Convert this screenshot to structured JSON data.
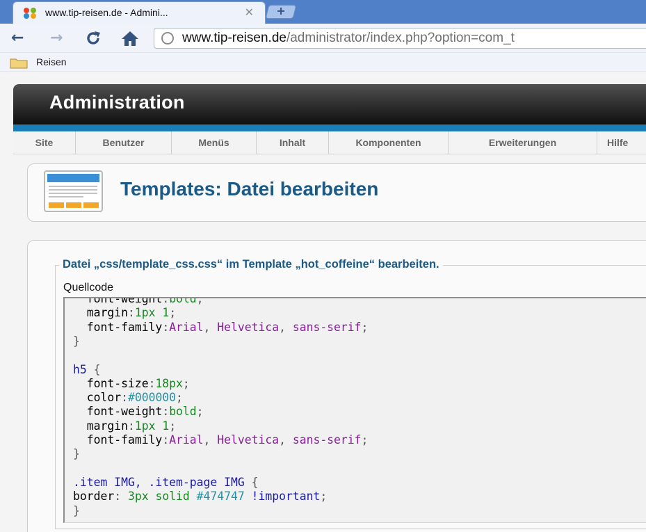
{
  "browser": {
    "tab_title": "www.tip-reisen.de - Admini...",
    "tab_close": "✕",
    "new_tab": "+",
    "back": "←",
    "forward": "→",
    "reload": "C",
    "home": "⌂",
    "url_host": "www.tip-reisen.de",
    "url_path": "/administrator/index.php?option=com_t",
    "bookmark_label": "Reisen",
    "icons": [
      "joomla-favicon",
      "back-arrow-icon",
      "forward-arrow-icon",
      "reload-icon",
      "home-icon",
      "globe-icon",
      "folder-icon"
    ]
  },
  "header": {
    "title": "Administration"
  },
  "menu": {
    "items": [
      "Site",
      "Benutzer",
      "Menüs",
      "Inhalt",
      "Komponenten",
      "Erweiterungen",
      "Hilfe"
    ]
  },
  "page": {
    "heading": "Templates: Datei bearbeiten",
    "legend": "Datei „css/template_css.css“ im Template „hot_coffeine“ bearbeiten.",
    "source_label": "Quellcode"
  },
  "code": {
    "lines": [
      "  font-weight:bold;",
      "  margin:1px 1;",
      "  font-family:Arial, Helvetica, sans-serif;",
      "}",
      "",
      "h5 {",
      "  font-size:18px;",
      "  color:#000000;",
      "  font-weight:bold;",
      "  margin:1px 1;",
      "  font-family:Arial, Helvetica, sans-serif;",
      "}",
      "",
      ".item IMG, .item-page IMG {",
      "border: 3px solid #474747 !important;",
      "}"
    ]
  },
  "colors": {
    "heading_blue": "#1b5a86",
    "accent_strip": "#1b7db8",
    "tab_strip": "#4f80c8",
    "code_number": "#14881e",
    "code_string": "#8b1f9d",
    "code_selector": "#1a1aa6",
    "code_color": "#2292a4"
  }
}
